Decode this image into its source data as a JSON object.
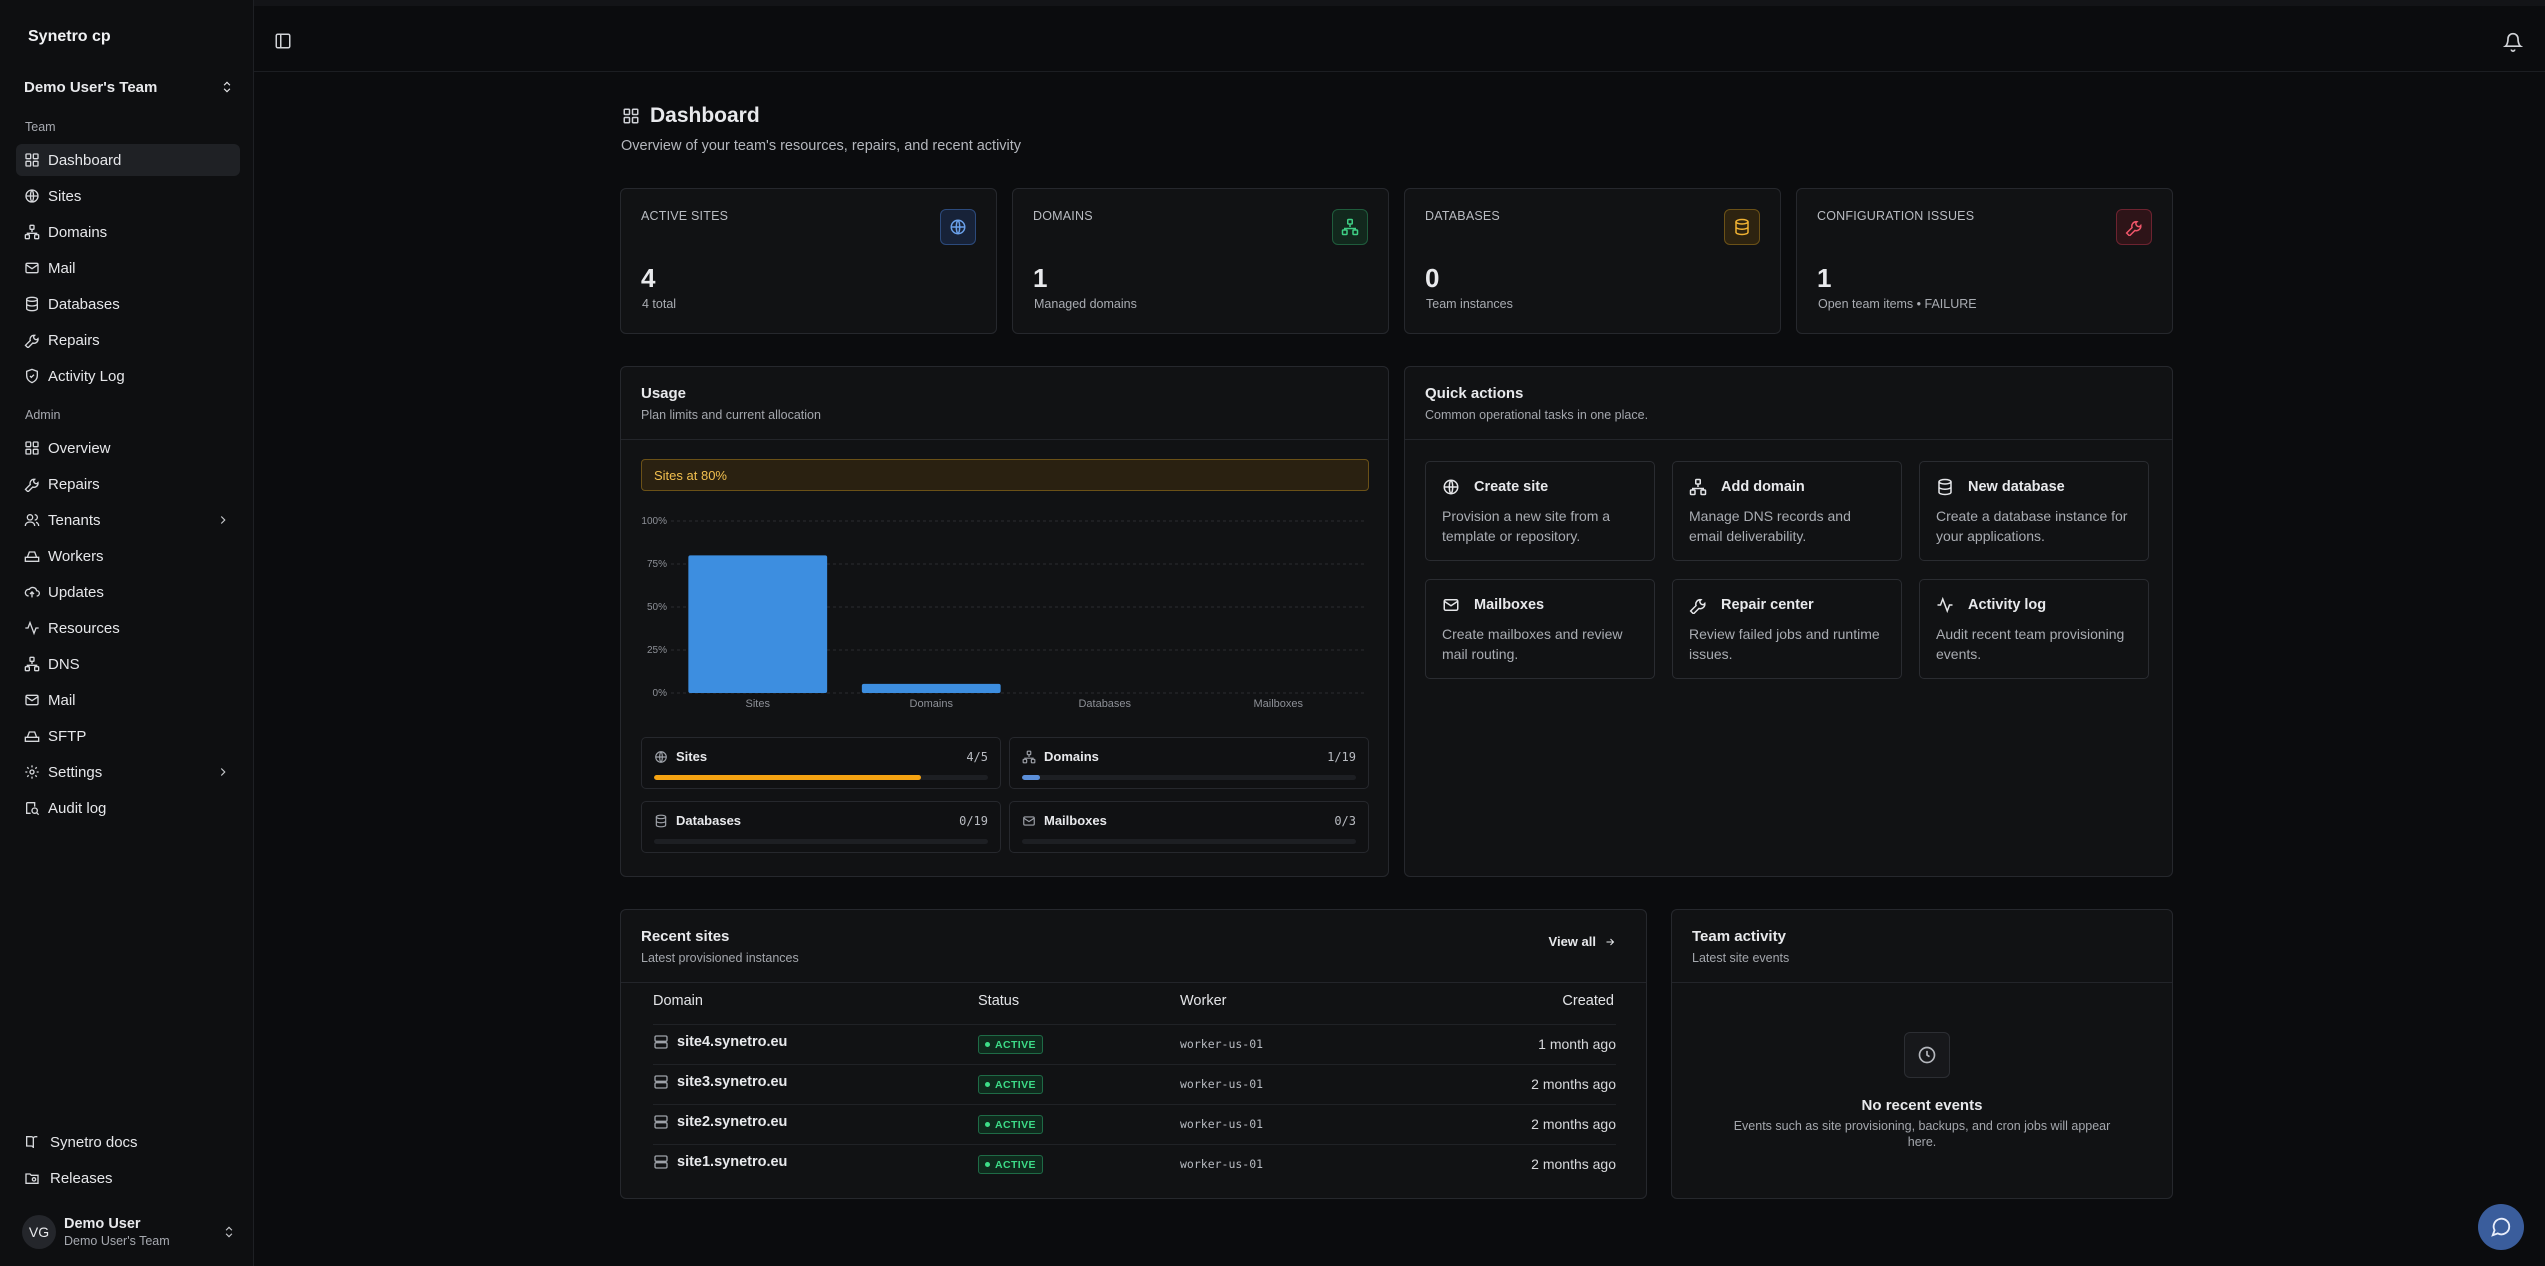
{
  "app": {
    "brand": "Synetro cp",
    "team_switcher": "Demo User's Team"
  },
  "sidebar": {
    "team_label": "Team",
    "team_items": [
      {
        "label": "Dashboard"
      },
      {
        "label": "Sites"
      },
      {
        "label": "Domains"
      },
      {
        "label": "Mail"
      },
      {
        "label": "Databases"
      },
      {
        "label": "Repairs"
      },
      {
        "label": "Activity Log"
      }
    ],
    "admin_label": "Admin",
    "admin_items": [
      {
        "label": "Overview"
      },
      {
        "label": "Repairs"
      },
      {
        "label": "Tenants"
      },
      {
        "label": "Workers"
      },
      {
        "label": "Updates"
      },
      {
        "label": "Resources"
      },
      {
        "label": "DNS"
      },
      {
        "label": "Mail"
      },
      {
        "label": "SFTP"
      },
      {
        "label": "Settings"
      },
      {
        "label": "Audit log"
      }
    ],
    "bottom_links": [
      {
        "label": "Synetro docs"
      },
      {
        "label": "Releases"
      }
    ],
    "user": {
      "initials": "VG",
      "name": "Demo User",
      "team": "Demo User's Team"
    }
  },
  "page": {
    "title": "Dashboard",
    "subtitle": "Overview of your team's resources, repairs, and recent activity"
  },
  "stats": [
    {
      "label": "ACTIVE SITES",
      "value": "4",
      "desc": "4 total",
      "icon": "globe-icon",
      "color": "#4f8fe0"
    },
    {
      "label": "DOMAINS",
      "value": "1",
      "desc": "Managed domains",
      "icon": "network-icon",
      "color": "#34c27a"
    },
    {
      "label": "DATABASES",
      "value": "0",
      "desc": "Team instances",
      "icon": "database-icon",
      "color": "#e2a321"
    },
    {
      "label": "CONFIGURATION ISSUES",
      "value": "1",
      "desc": "Open team items • FAILURE",
      "icon": "wrench-icon",
      "color": "#e0455a"
    }
  ],
  "usage": {
    "title": "Usage",
    "subtitle": "Plan limits and current allocation",
    "warning": "Sites at 80%",
    "tiles": [
      {
        "name": "Sites",
        "count": "4/5",
        "fraction": 0.8,
        "color": "#f5a312",
        "icon": "globe-icon"
      },
      {
        "name": "Domains",
        "count": "1/19",
        "fraction": 0.0526,
        "color": "#5b8fd9",
        "icon": "network-icon"
      },
      {
        "name": "Databases",
        "count": "0/19",
        "fraction": 0,
        "color": "#5b8fd9",
        "icon": "database-icon"
      },
      {
        "name": "Mailboxes",
        "count": "0/3",
        "fraction": 0,
        "color": "#5b8fd9",
        "icon": "mail-icon"
      }
    ]
  },
  "chart_data": {
    "type": "bar",
    "categories": [
      "Sites",
      "Domains",
      "Databases",
      "Mailboxes"
    ],
    "values": [
      80,
      5.3,
      0,
      0
    ],
    "ylim": [
      0,
      100
    ],
    "yticks": [
      "100%",
      "75%",
      "50%",
      "25%",
      "0%"
    ],
    "grid": true,
    "bar_color": "#3d8ee0"
  },
  "quick_actions": {
    "title": "Quick actions",
    "subtitle": "Common operational tasks in one place.",
    "items": [
      {
        "title": "Create site",
        "desc": "Provision a new site from a template or repository.",
        "icon": "globe-icon"
      },
      {
        "title": "Add domain",
        "desc": "Manage DNS records and email deliverability.",
        "icon": "network-icon"
      },
      {
        "title": "New database",
        "desc": "Create a database instance for your applications.",
        "icon": "database-icon"
      },
      {
        "title": "Mailboxes",
        "desc": "Create mailboxes and review mail routing.",
        "icon": "mail-icon"
      },
      {
        "title": "Repair center",
        "desc": "Review failed jobs and runtime issues.",
        "icon": "wrench-icon"
      },
      {
        "title": "Activity log",
        "desc": "Audit recent team provisioning events.",
        "icon": "activity-icon"
      }
    ]
  },
  "recent_sites": {
    "title": "Recent sites",
    "subtitle": "Latest provisioned instances",
    "view_all": "View all",
    "columns": [
      "Domain",
      "Status",
      "Worker",
      "Created"
    ],
    "rows": [
      {
        "domain": "site4.synetro.eu",
        "status": "ACTIVE",
        "worker": "worker-us-01",
        "created": "1 month ago"
      },
      {
        "domain": "site3.synetro.eu",
        "status": "ACTIVE",
        "worker": "worker-us-01",
        "created": "2 months ago"
      },
      {
        "domain": "site2.synetro.eu",
        "status": "ACTIVE",
        "worker": "worker-us-01",
        "created": "2 months ago"
      },
      {
        "domain": "site1.synetro.eu",
        "status": "ACTIVE",
        "worker": "worker-us-01",
        "created": "2 months ago"
      }
    ]
  },
  "team_activity": {
    "title": "Team activity",
    "subtitle": "Latest site events",
    "empty_title": "No recent events",
    "empty_desc": "Events such as site provisioning, backups, and cron jobs will appear here."
  }
}
